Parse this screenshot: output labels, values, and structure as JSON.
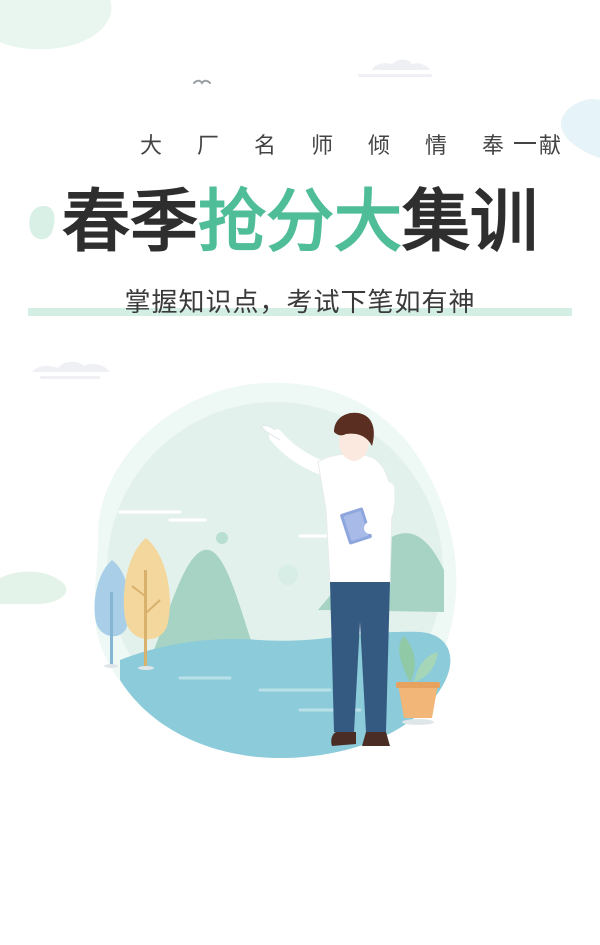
{
  "banner": {
    "eyebrow": "大 厂 名 师 倾 情 奉 献",
    "headline": {
      "part1": "春季",
      "part2": "抢分大",
      "part3": "集训"
    },
    "tagline": "掌握知识点，考试下笔如有神"
  },
  "colors": {
    "accent": "#4fbd97",
    "headline_dark": "#2e2e2e",
    "tagline_underline": "#d3eee3",
    "water": "#8ccbd9",
    "hills": "#a6d3c3",
    "pants": "#345a82",
    "hair": "#5a2f22"
  },
  "icons": {
    "bird": "bird-icon",
    "potted_plant": "potted-plant-icon",
    "tablet": "tablet-icon"
  }
}
